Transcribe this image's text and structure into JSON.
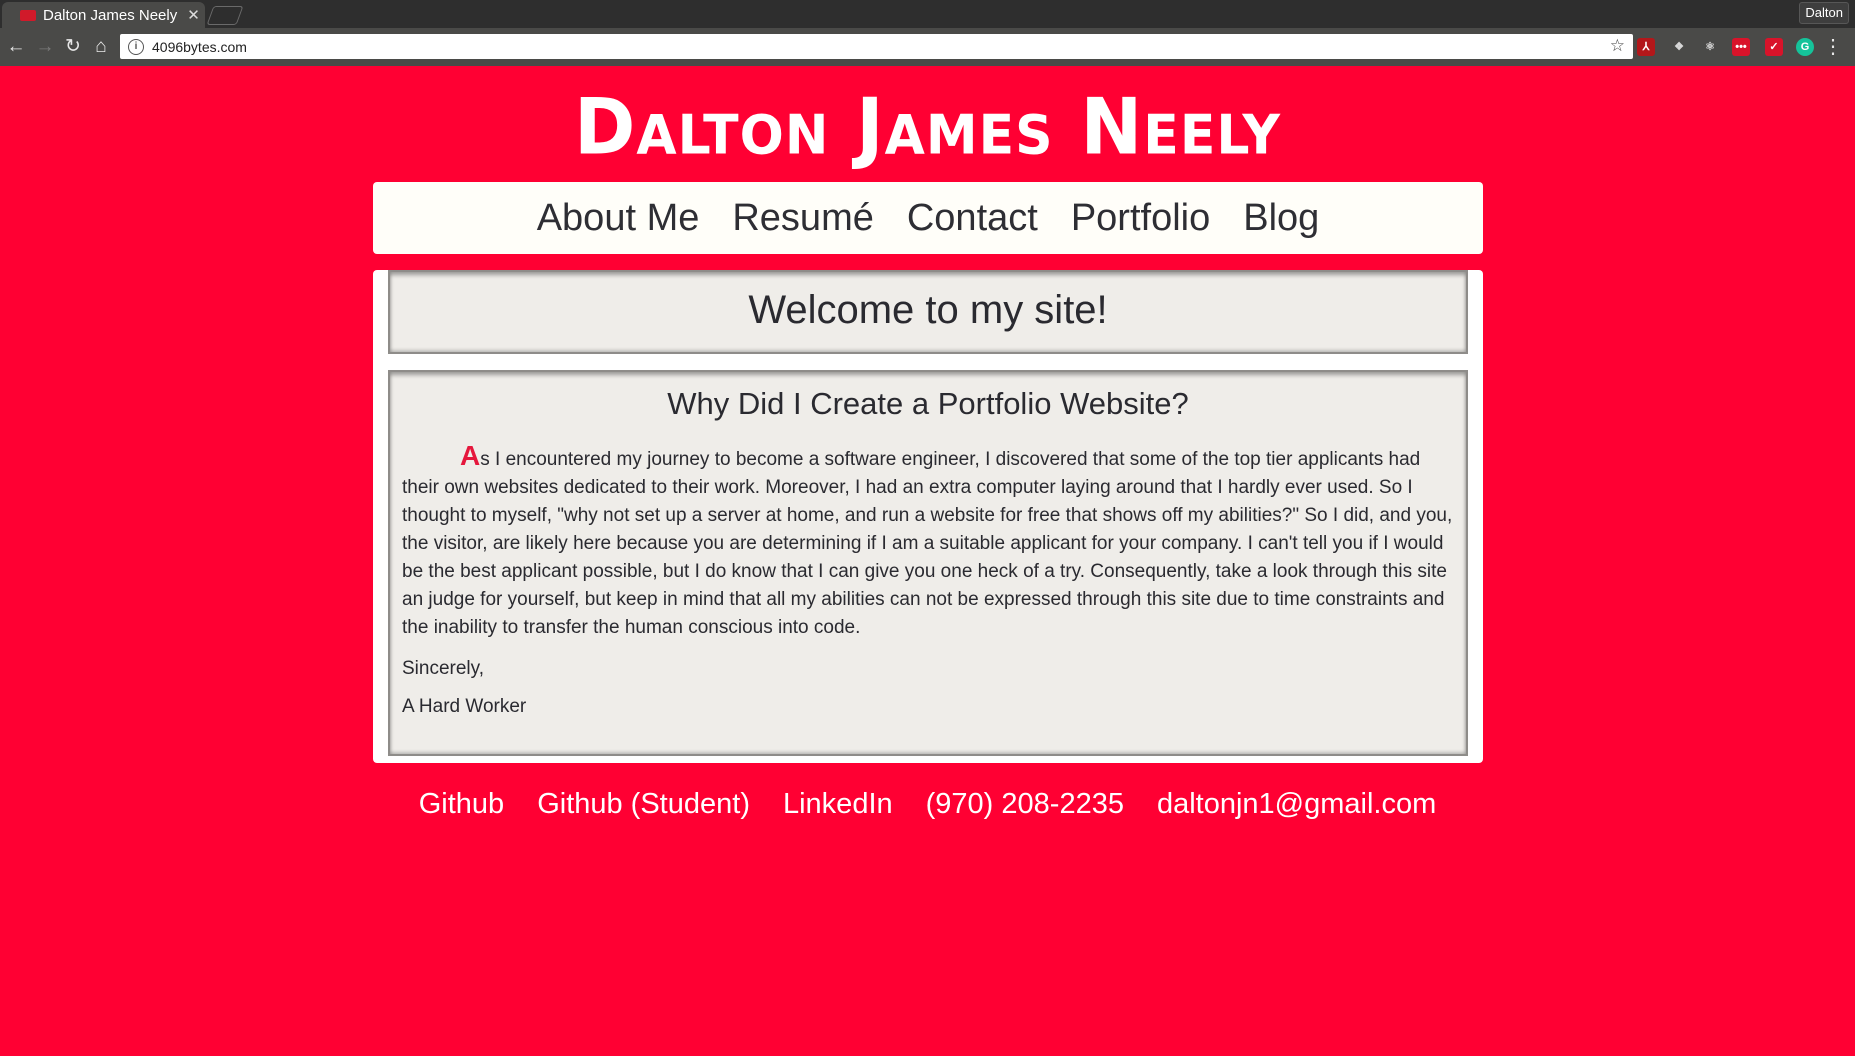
{
  "browser": {
    "tab_title": "Dalton James Neely",
    "tab_close": "✕",
    "profile_name": "Dalton",
    "url": "4096bytes.com",
    "colors": {
      "tabbar": "#2e2e2e",
      "toolbar": "#4a4a48"
    }
  },
  "site": {
    "title": "Dalton James Neely",
    "background_color": "#ff0033"
  },
  "nav": {
    "items": [
      "About Me",
      "Resumé",
      "Contact",
      "Portfolio",
      "Blog"
    ]
  },
  "welcome": {
    "heading": "Welcome to my site!"
  },
  "article": {
    "heading": "Why Did I Create a Portfolio Website?",
    "dropcap": "A",
    "body": "s I encountered my journey to become a software engineer, I discovered that some of the top tier applicants had their own websites dedicated to their work. Moreover, I had an extra computer laying around that I hardly ever used. So I thought to myself, \"why not set up a server at home, and run a website for free that shows off my abilities?\" So I did, and you, the visitor, are likely here because you are determining if I am a suitable applicant for your company. I can't tell you if I would be the best applicant possible, but I do know that I can give you one heck of a try. Consequently, take a look through this site an judge for yourself, but keep in mind that all my abilities can not be expressed through this site due to time constraints and the inability to transfer the human conscious into code.",
    "closing": "Sincerely,",
    "signature": "A Hard Worker"
  },
  "footer": {
    "items": [
      "Github",
      "Github (Student)",
      "LinkedIn",
      "(970) 208-2235",
      "daltonjn1@gmail.com"
    ]
  }
}
